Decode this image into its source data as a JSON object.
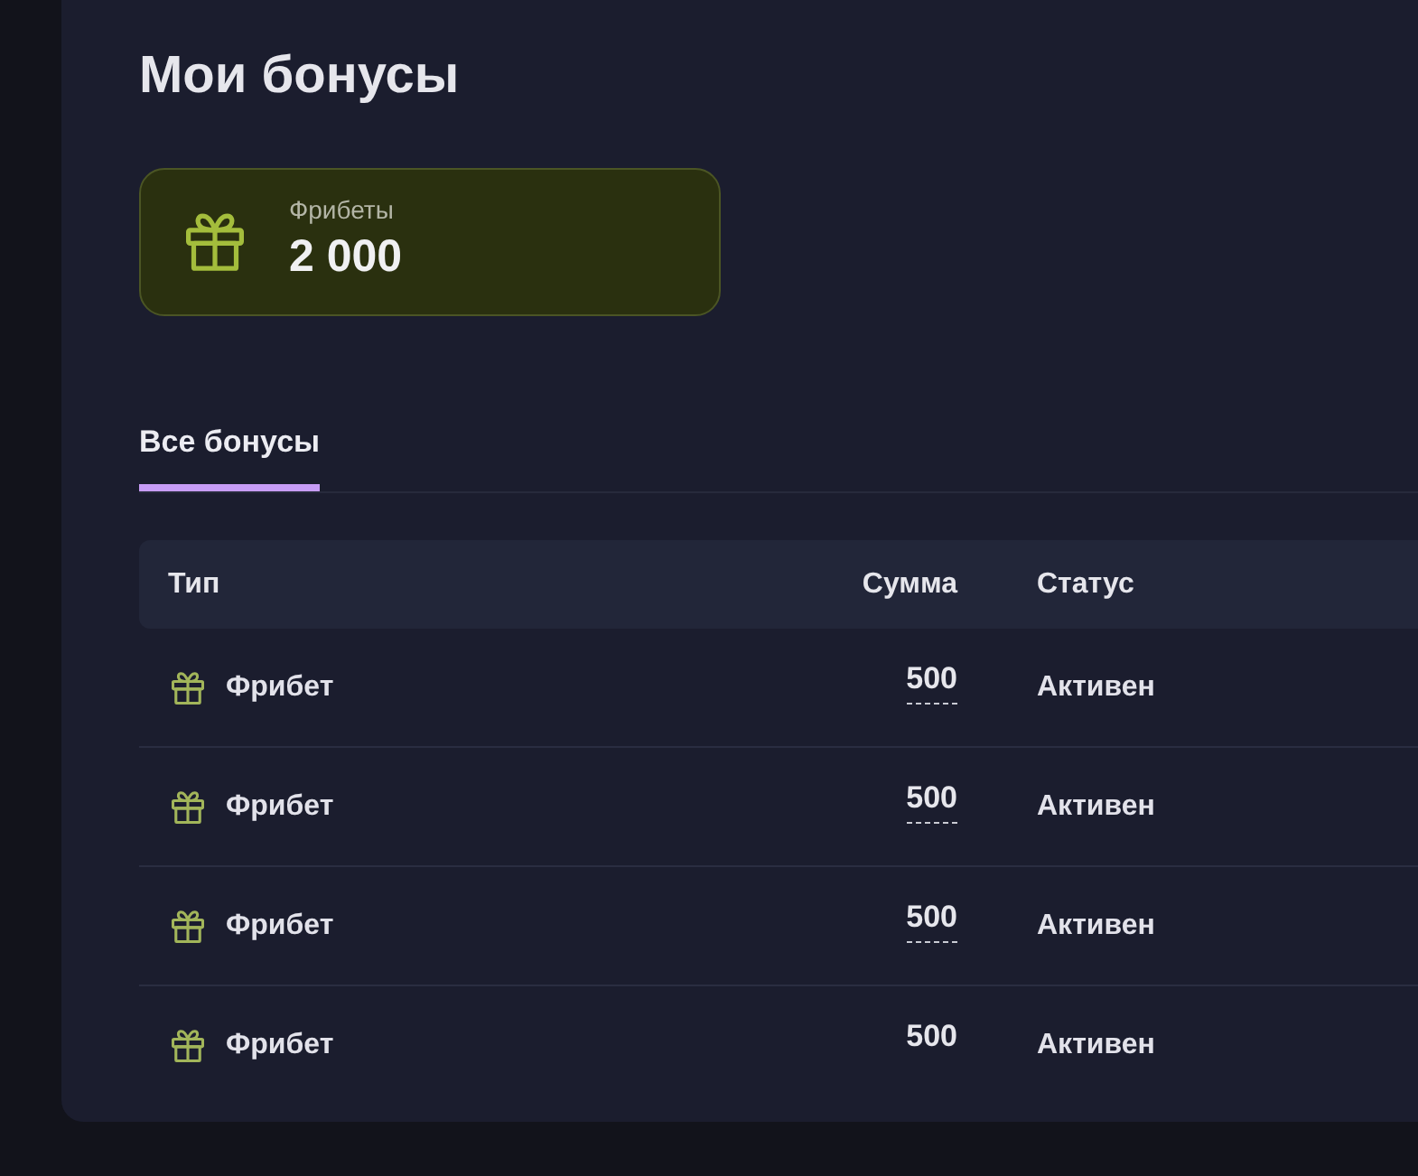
{
  "page": {
    "title": "Мои бонусы"
  },
  "summary_card": {
    "label": "Фрибеты",
    "value": "2 000"
  },
  "tabs": [
    {
      "label": "Все бонусы",
      "selected": true
    }
  ],
  "table": {
    "columns": [
      "Тип",
      "Сумма",
      "Статус"
    ],
    "rows": [
      {
        "type": "Фрибет",
        "amount": "500",
        "amount_underlined": true,
        "status": "Активен"
      },
      {
        "type": "Фрибет",
        "amount": "500",
        "amount_underlined": true,
        "status": "Активен"
      },
      {
        "type": "Фрибет",
        "amount": "500",
        "amount_underlined": true,
        "status": "Активен"
      },
      {
        "type": "Фрибет",
        "amount": "500",
        "amount_underlined": false,
        "status": "Активен"
      }
    ]
  }
}
